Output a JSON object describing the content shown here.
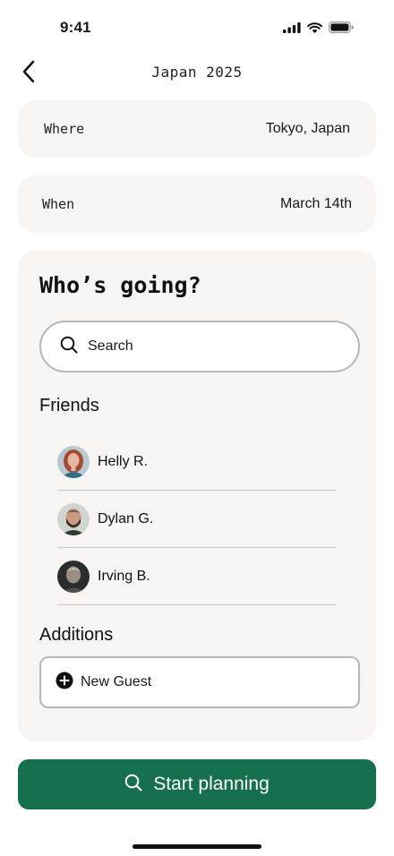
{
  "status_bar": {
    "time": "9:41",
    "icons": [
      "cellular-signal-icon",
      "wifi-icon",
      "battery-icon"
    ]
  },
  "nav": {
    "back_icon": "chevron-left-icon",
    "title": "Japan 2025"
  },
  "details": {
    "where": {
      "label": "Where",
      "value": "Tokyo, Japan"
    },
    "when": {
      "label": "When",
      "value": "March 14th"
    }
  },
  "who_going": {
    "title": "Who’s going?",
    "search": {
      "placeholder": "Search",
      "icon": "search-icon"
    },
    "friends_heading": "Friends",
    "friends": [
      {
        "name": "Helly R.",
        "avatar": "avatar-helly"
      },
      {
        "name": "Dylan G.",
        "avatar": "avatar-dylan"
      },
      {
        "name": "Irving B.",
        "avatar": "avatar-irving"
      }
    ],
    "additions_heading": "Additions",
    "new_guest": {
      "label": "New Guest",
      "icon": "plus-circle-icon"
    }
  },
  "cta": {
    "label": "Start planning",
    "icon": "search-icon"
  },
  "colors": {
    "card_background": "#f7f4f1",
    "field_border": "#b9b6b3",
    "cta_green": "#16704e",
    "divider": "#c9c6c3"
  }
}
